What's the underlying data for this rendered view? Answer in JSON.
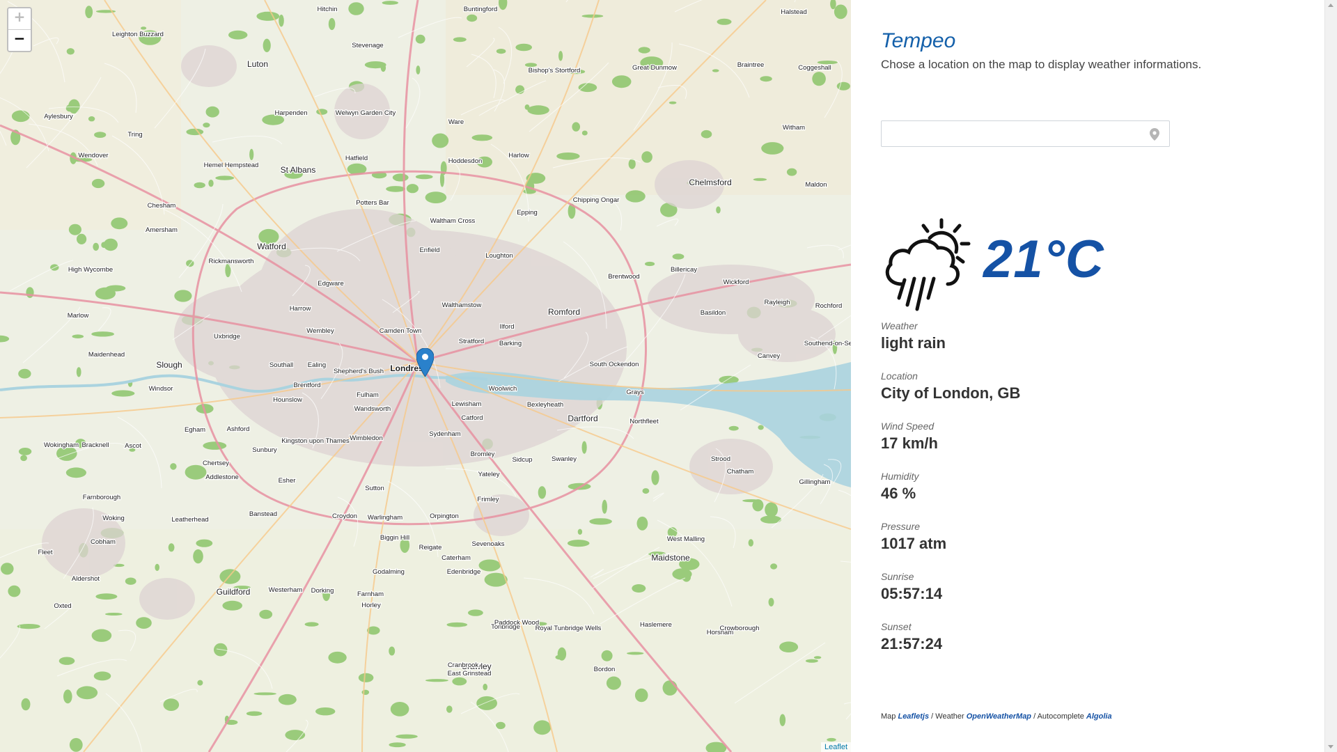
{
  "map": {
    "zoom_in": "+",
    "zoom_out": "−",
    "attribution": "Leaflet",
    "labels": [
      {
        "text": "Hitchin"
      },
      {
        "text": "Buntingford"
      },
      {
        "text": "Stevenage"
      },
      {
        "text": "Luton"
      },
      {
        "text": "Leighton Buzzard"
      },
      {
        "text": "Aylesbury"
      },
      {
        "text": "Harpenden"
      },
      {
        "text": "Welwyn Garden City"
      },
      {
        "text": "Ware"
      },
      {
        "text": "Bishop's Stortford"
      },
      {
        "text": "Great Dunmow"
      },
      {
        "text": "Braintree"
      },
      {
        "text": "Coggeshall"
      },
      {
        "text": "Halstead"
      },
      {
        "text": "Witham"
      },
      {
        "text": "Hatfield"
      },
      {
        "text": "St Albans"
      },
      {
        "text": "Hemel Hempstead"
      },
      {
        "text": "Tring"
      },
      {
        "text": "Wendover"
      },
      {
        "text": "Chelmsford"
      },
      {
        "text": "Maldon"
      },
      {
        "text": "Harlow"
      },
      {
        "text": "Hoddesdon"
      },
      {
        "text": "Epping"
      },
      {
        "text": "Chipping Ongar"
      },
      {
        "text": "Potters Bar"
      },
      {
        "text": "Watford"
      },
      {
        "text": "Chesham"
      },
      {
        "text": "Amersham"
      },
      {
        "text": "High Wycombe"
      },
      {
        "text": "Rickmansworth"
      },
      {
        "text": "Enfield"
      },
      {
        "text": "Waltham Cross"
      },
      {
        "text": "Loughton"
      },
      {
        "text": "Brentwood"
      },
      {
        "text": "Billericay"
      },
      {
        "text": "Wickford"
      },
      {
        "text": "Rayleigh"
      },
      {
        "text": "Rochford"
      },
      {
        "text": "Southend-on-Sea"
      },
      {
        "text": "Basildon"
      },
      {
        "text": "Canvey"
      },
      {
        "text": "Edgware"
      },
      {
        "text": "Harrow"
      },
      {
        "text": "Walthamstow"
      },
      {
        "text": "Ilford"
      },
      {
        "text": "Romford"
      },
      {
        "text": "Marlow"
      },
      {
        "text": "Maidenhead"
      },
      {
        "text": "Slough"
      },
      {
        "text": "Uxbridge"
      },
      {
        "text": "Wembley"
      },
      {
        "text": "Camden Town"
      },
      {
        "text": "Stratford"
      },
      {
        "text": "Barking"
      },
      {
        "text": "Londres"
      },
      {
        "text": "Windsor"
      },
      {
        "text": "Hounslow"
      },
      {
        "text": "Southall"
      },
      {
        "text": "Ealing"
      },
      {
        "text": "Brentford"
      },
      {
        "text": "Shepherd's Bush"
      },
      {
        "text": "Fulham"
      },
      {
        "text": "Lewisham"
      },
      {
        "text": "Woolwich"
      },
      {
        "text": "Grays"
      },
      {
        "text": "South Ockendon"
      },
      {
        "text": "Bexleyheath"
      },
      {
        "text": "Dartford"
      },
      {
        "text": "Northfleet"
      },
      {
        "text": "Wandsworth"
      },
      {
        "text": "Catford"
      },
      {
        "text": "Sydenham"
      },
      {
        "text": "Wimbledon"
      },
      {
        "text": "Egham"
      },
      {
        "text": "Ashford"
      },
      {
        "text": "Sunbury"
      },
      {
        "text": "Kingston upon Thames"
      },
      {
        "text": "Bromley"
      },
      {
        "text": "Sidcup"
      },
      {
        "text": "Swanley"
      },
      {
        "text": "Chatham"
      },
      {
        "text": "Strood"
      },
      {
        "text": "Gillingham"
      },
      {
        "text": "Wokingham"
      },
      {
        "text": "Bracknell"
      },
      {
        "text": "Ascot"
      },
      {
        "text": "Chertsey"
      },
      {
        "text": "Addlestone"
      },
      {
        "text": "Esher"
      },
      {
        "text": "Sutton"
      },
      {
        "text": "Croydon"
      },
      {
        "text": "Orpington"
      },
      {
        "text": "Yateley"
      },
      {
        "text": "Frimley"
      },
      {
        "text": "Farnborough"
      },
      {
        "text": "Woking"
      },
      {
        "text": "Cobham"
      },
      {
        "text": "Leatherhead"
      },
      {
        "text": "Banstead"
      },
      {
        "text": "Warlingham"
      },
      {
        "text": "Biggin Hill"
      },
      {
        "text": "Sevenoaks"
      },
      {
        "text": "West Malling"
      },
      {
        "text": "Maidstone"
      },
      {
        "text": "Fleet"
      },
      {
        "text": "Aldershot"
      },
      {
        "text": "Guildford"
      },
      {
        "text": "Dorking"
      },
      {
        "text": "Reigate"
      },
      {
        "text": "Caterham"
      },
      {
        "text": "Oxted"
      },
      {
        "text": "Westerham"
      },
      {
        "text": "Farnham"
      },
      {
        "text": "Godalming"
      },
      {
        "text": "Horley"
      },
      {
        "text": "Edenbridge"
      },
      {
        "text": "Tonbridge"
      },
      {
        "text": "Paddock Wood"
      },
      {
        "text": "Royal Tunbridge Wells"
      },
      {
        "text": "East Grinstead"
      },
      {
        "text": "Crawley"
      },
      {
        "text": "Haslemere"
      },
      {
        "text": "Horsham"
      },
      {
        "text": "Crowborough"
      },
      {
        "text": "Cranbrook"
      },
      {
        "text": "Bordon"
      }
    ]
  },
  "panel": {
    "title": "Tempeo",
    "subtitle": "Chose a location on the map to display weather informations.",
    "search": {
      "value": "",
      "placeholder": "",
      "icon": "map-pin-icon"
    },
    "weather_icon": "cloud-rain-sun-icon",
    "temperature": "21°C",
    "stats": [
      {
        "label": "Weather",
        "value": "light rain"
      },
      {
        "label": "Location",
        "value": "City of London, GB"
      },
      {
        "label": "Wind Speed",
        "value": "17 km/h"
      },
      {
        "label": "Humidity",
        "value": "46 %"
      },
      {
        "label": "Pressure",
        "value": "1017 atm"
      },
      {
        "label": "Sunrise",
        "value": "05:57:14"
      },
      {
        "label": "Sunset",
        "value": "21:57:24"
      }
    ],
    "footer": {
      "map_prefix": "Map ",
      "map_link": "Leafletjs",
      "weather_prefix": " / Weather ",
      "weather_link": "OpenWeatherMap",
      "auto_prefix": " / Autocomplete ",
      "auto_link": "Algolia"
    }
  },
  "colors": {
    "accent": "#1552a5",
    "title": "#1460aa",
    "marker": "#2a81cb",
    "map_bg": "#eef0e4",
    "woods": "#8cc56a",
    "urban": "#e8d8d8",
    "motorway": "#e892a2"
  }
}
